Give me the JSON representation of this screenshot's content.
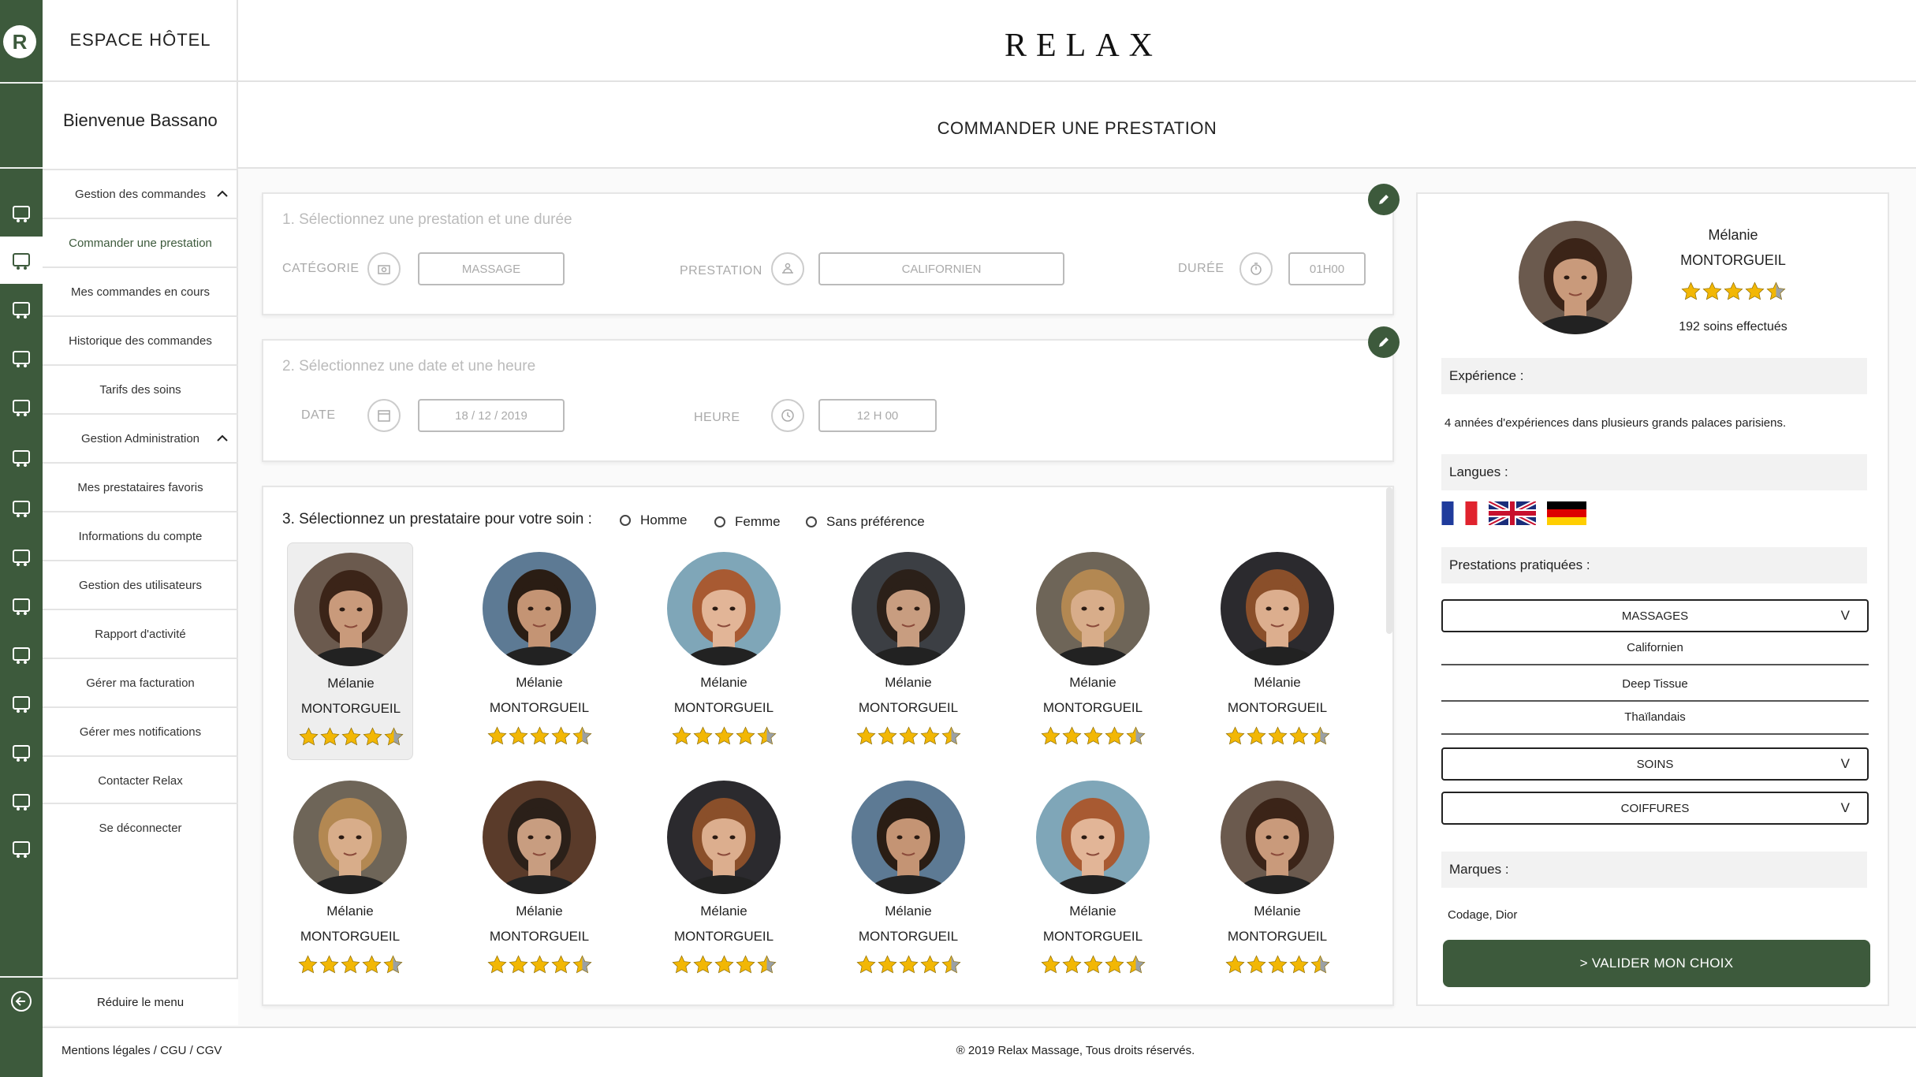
{
  "app": {
    "space_title": "ESPACE HÔTEL",
    "brand": "RELAX",
    "welcome": "Bienvenue Bassano",
    "page_title": "COMMANDER UNE PRESTATION",
    "logo_letter": "R"
  },
  "colors": {
    "accent": "#3d5a3c",
    "star": "#f2b705",
    "star_empty": "#9aa0a6"
  },
  "sidebar": {
    "items": [
      {
        "label": "Gestion des commandes",
        "group": true,
        "icon": "cart-icon"
      },
      {
        "label": "Commander une prestation",
        "active": true,
        "icon": "cart-outline-icon"
      },
      {
        "label": "Mes commandes en cours",
        "icon": "cart-icon"
      },
      {
        "label": "Historique des commandes",
        "icon": "clipboard-icon"
      },
      {
        "label": "Tarifs des soins",
        "icon": "price-list-icon"
      },
      {
        "label": "Gestion Administration",
        "group": true,
        "icon": "gears-icon"
      },
      {
        "label": "Mes prestataires favoris",
        "icon": "star-badge-icon"
      },
      {
        "label": "Informations du compte",
        "icon": "id-card-icon"
      },
      {
        "label": "Gestion des utilisateurs",
        "icon": "users-icon"
      },
      {
        "label": "Rapport d'activité",
        "icon": "chart-search-icon"
      },
      {
        "label": "Gérer ma facturation",
        "icon": "invoice-icon"
      },
      {
        "label": "Gérer mes notifications",
        "icon": "bell-icon"
      },
      {
        "label": "Contacter Relax",
        "icon": "envelope-icon"
      },
      {
        "label": "Se déconnecter",
        "icon": "logout-icon"
      }
    ],
    "reduce_label": "Réduire le menu"
  },
  "step1": {
    "title": "1. Sélectionnez une prestation et une durée",
    "category_label": "CATÉGORIE",
    "category_value": "MASSAGE",
    "prestation_label": "PRESTATION",
    "prestation_value": "CALIFORNIEN",
    "duration_label": "DURÉE",
    "duration_value": "01H00"
  },
  "step2": {
    "title": "2. Sélectionnez une date et une heure",
    "date_label": "DATE",
    "date_value": "18  / 12  / 2019",
    "time_label": "HEURE",
    "time_value": "12 H 00"
  },
  "step3": {
    "title": "3. Sélectionnez un prestataire pour votre soin :",
    "options": [
      "Homme",
      "Femme",
      "Sans préférence"
    ],
    "providers": [
      {
        "first": "Mélanie",
        "last": "MONTORGUEIL",
        "rating": 4.5,
        "selected": true,
        "skin": "#c99a7b",
        "hair": "#3b2418",
        "bg": "#6b5a4e"
      },
      {
        "first": "Mélanie",
        "last": "MONTORGUEIL",
        "rating": 4.5,
        "skin": "#c49474",
        "hair": "#2a1d14",
        "bg": "#5d7a94"
      },
      {
        "first": "Mélanie",
        "last": "MONTORGUEIL",
        "rating": 4.5,
        "skin": "#e2b597",
        "hair": "#a85a32",
        "bg": "#7fa6b8"
      },
      {
        "first": "Mélanie",
        "last": "MONTORGUEIL",
        "rating": 4.5,
        "skin": "#c89d80",
        "hair": "#2b2019",
        "bg": "#3c3f44"
      },
      {
        "first": "Mélanie",
        "last": "MONTORGUEIL",
        "rating": 4.5,
        "skin": "#d8ad8a",
        "hair": "#b38852",
        "bg": "#6e6558"
      },
      {
        "first": "Mélanie",
        "last": "MONTORGUEIL",
        "rating": 4.5,
        "skin": "#dcae8e",
        "hair": "#8a4f2a",
        "bg": "#2b2a2e"
      },
      {
        "first": "Mélanie",
        "last": "MONTORGUEIL",
        "rating": 4.5,
        "skin": "#d8ad8a",
        "hair": "#b38852",
        "bg": "#6e6558"
      },
      {
        "first": "Mélanie",
        "last": "MONTORGUEIL",
        "rating": 4.5,
        "skin": "#c89d80",
        "hair": "#2b2019",
        "bg": "#5a3b2a"
      },
      {
        "first": "Mélanie",
        "last": "MONTORGUEIL",
        "rating": 4.5,
        "skin": "#dcae8e",
        "hair": "#8a4f2a",
        "bg": "#2b2a2e"
      },
      {
        "first": "Mélanie",
        "last": "MONTORGUEIL",
        "rating": 4.5,
        "skin": "#c49474",
        "hair": "#2a1d14",
        "bg": "#5d7a94"
      },
      {
        "first": "Mélanie",
        "last": "MONTORGUEIL",
        "rating": 4.5,
        "skin": "#e2b597",
        "hair": "#a85a32",
        "bg": "#7fa6b8"
      },
      {
        "first": "Mélanie",
        "last": "MONTORGUEIL",
        "rating": 4.5,
        "skin": "#c99a7b",
        "hair": "#3b2418",
        "bg": "#6b5a4e"
      }
    ]
  },
  "detail": {
    "first": "Mélanie",
    "last": "MONTORGUEIL",
    "rating": 4.5,
    "soins": "192 soins effectués",
    "experience_label": "Expérience :",
    "experience_text": "4 années d'expériences dans plusieurs grands palaces parisiens.",
    "languages_label": "Langues :",
    "languages": [
      "fr-flag-icon",
      "uk-flag-icon",
      "de-flag-icon"
    ],
    "prestations_label": "Prestations pratiquées :",
    "massages_label": "MASSAGES",
    "massages_items": [
      "Californien",
      "Deep Tissue",
      "Thaïlandais"
    ],
    "soins_label": "SOINS",
    "coiffures_label": "COIFFURES",
    "chevron": "V",
    "brands_label": "Marques :",
    "brands_text": "Codage, Dior",
    "validate_label": "> VALIDER MON CHOIX"
  },
  "footer": {
    "legal": "Mentions légales / CGU / CGV",
    "copyright": "® 2019 Relax Massage, Tous droits réservés."
  }
}
